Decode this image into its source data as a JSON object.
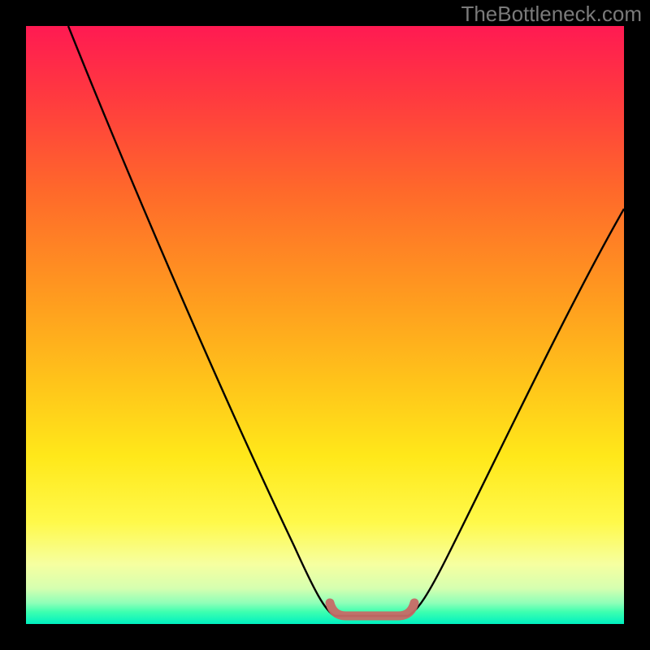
{
  "watermark": {
    "text": "TheBottleneck.com"
  },
  "colors": {
    "curve": "#000000",
    "trough_marker": "#c76a66",
    "trough_marker_opacity": 0.95,
    "background_black": "#000000"
  },
  "chart_data": {
    "type": "line",
    "title": "",
    "xlabel": "",
    "ylabel": "",
    "xlim": [
      0,
      100
    ],
    "ylim": [
      0,
      100
    ],
    "grid": false,
    "series": [
      {
        "name": "curve",
        "x": [
          0,
          5,
          10,
          15,
          20,
          25,
          30,
          35,
          40,
          45,
          50,
          52,
          55,
          58,
          62,
          65,
          70,
          75,
          80,
          85,
          90,
          95,
          100
        ],
        "y": [
          100,
          90,
          80,
          70,
          60,
          50,
          40,
          30,
          20,
          12,
          4,
          0,
          0,
          0,
          0,
          4,
          12,
          20,
          28,
          36,
          44,
          50,
          55
        ]
      }
    ],
    "annotations": [
      {
        "name": "trough-band",
        "x_start": 50,
        "x_end": 64,
        "y": 0
      }
    ],
    "legend": false
  }
}
